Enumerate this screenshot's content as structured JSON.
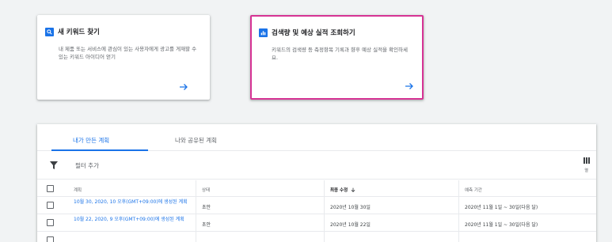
{
  "cards": [
    {
      "title": "새 키워드 찾기",
      "description": "내 제품 또는 서비스에 관심이 있는 사용자에게 광고를 게재할 수 있는 키워드 아이디어 얻기",
      "icon": "search-icon"
    },
    {
      "title": "검색량 및 예상 실적 조회하기",
      "description": "키워드의 검색량 등 측정항목 기록과 향후 예상 실적을 확인하세요.",
      "icon": "bar-chart-icon"
    }
  ],
  "tabs": [
    "내가 만든 계획",
    "나와 공유된 계획"
  ],
  "filter": {
    "label": "필터 추가",
    "columns_label": "열"
  },
  "table": {
    "headers": {
      "plan": "계획",
      "status": "상태",
      "modified": "최종 수정",
      "forecast": "예측 기간"
    },
    "rows": [
      {
        "plan": "10월 30, 2020, 10 오후(GMT+09:00)에 생성된 계획",
        "status": "초안",
        "modified": "2020년 10월 30일",
        "forecast": "2020년 11월 1일 ~ 30일(다음 달)"
      },
      {
        "plan": "10월 22, 2020, 9 오후(GMT+09:00)에 생성된 계획",
        "status": "초안",
        "modified": "2020년 10월 22일",
        "forecast": "2020년 11월 1일 ~ 30일(다음 달)"
      },
      {
        "plan": "",
        "status": "",
        "modified": "",
        "forecast": ""
      }
    ]
  },
  "colors": {
    "accent": "#1a73e8",
    "highlight_border": "#d63394"
  }
}
